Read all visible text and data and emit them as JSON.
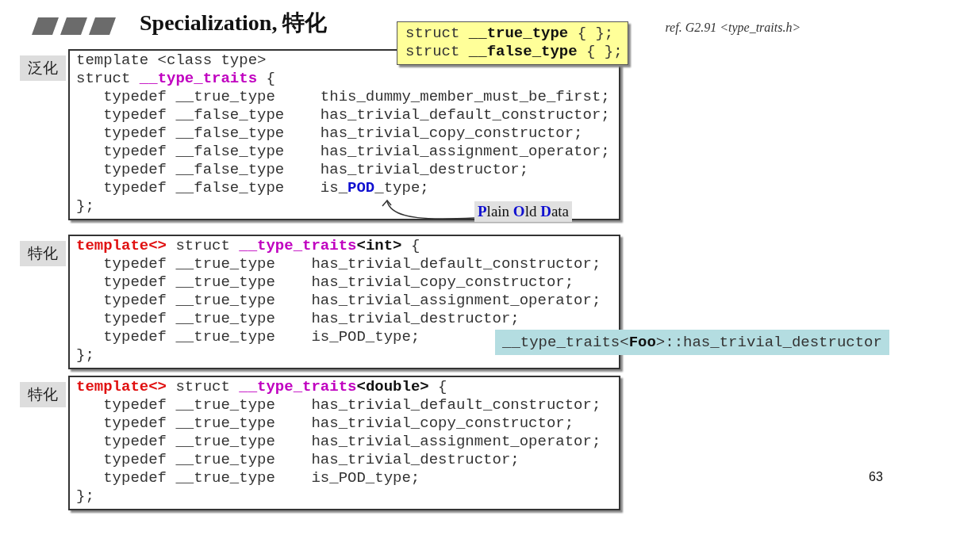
{
  "slide": {
    "title": "Specialization, 特化",
    "reference": "ref. G2.91 <type_traits.h>",
    "page_number": "63"
  },
  "note_box": {
    "lines": [
      [
        {
          "text": "struct ",
          "kind": "plain"
        },
        {
          "text": "__true_type",
          "kind": "bold"
        },
        {
          "text": " { };",
          "kind": "plain"
        }
      ],
      [
        {
          "text": "struct ",
          "kind": "plain"
        },
        {
          "text": "__false_type",
          "kind": "bold"
        },
        {
          "text": " { };",
          "kind": "plain"
        }
      ]
    ]
  },
  "blocks": [
    {
      "label": "泛化",
      "lines": [
        [
          {
            "text": "template <class type>",
            "kind": "plain"
          }
        ],
        [
          {
            "text": "struct ",
            "kind": "plain"
          },
          {
            "text": "__type_traits",
            "kind": "name"
          },
          {
            "text": " {",
            "kind": "plain"
          }
        ],
        [
          {
            "text": "   typedef __true_type     this_dummy_member_must_be_first;",
            "kind": "plain"
          }
        ],
        [
          {
            "text": "   typedef __false_type    has_trivial_default_constructor;",
            "kind": "plain"
          }
        ],
        [
          {
            "text": "   typedef __false_type    has_trivial_copy_constructor;",
            "kind": "plain"
          }
        ],
        [
          {
            "text": "   typedef __false_type    has_trivial_assignment_operator;",
            "kind": "plain"
          }
        ],
        [
          {
            "text": "   typedef __false_type    has_trivial_destructor;",
            "kind": "plain"
          }
        ],
        [
          {
            "text": "   typedef __false_type    is_",
            "kind": "plain"
          },
          {
            "text": "POD",
            "kind": "pod"
          },
          {
            "text": "_type;",
            "kind": "plain"
          }
        ],
        [
          {
            "text": "};",
            "kind": "plain"
          }
        ]
      ]
    },
    {
      "label": "特化",
      "lines": [
        [
          {
            "text": "template<>",
            "kind": "template"
          },
          {
            "text": " struct ",
            "kind": "plain"
          },
          {
            "text": "__type_traits",
            "kind": "name"
          },
          {
            "text": "<int>",
            "kind": "bold"
          },
          {
            "text": " {",
            "kind": "plain"
          }
        ],
        [
          {
            "text": "   typedef __true_type    has_trivial_default_constructor;",
            "kind": "plain"
          }
        ],
        [
          {
            "text": "   typedef __true_type    has_trivial_copy_constructor;",
            "kind": "plain"
          }
        ],
        [
          {
            "text": "   typedef __true_type    has_trivial_assignment_operator;",
            "kind": "plain"
          }
        ],
        [
          {
            "text": "   typedef __true_type    has_trivial_destructor;",
            "kind": "plain"
          }
        ],
        [
          {
            "text": "   typedef __true_type    is_POD_type;",
            "kind": "plain"
          }
        ],
        [
          {
            "text": "};",
            "kind": "plain"
          }
        ]
      ]
    },
    {
      "label": "特化",
      "lines": [
        [
          {
            "text": "template<>",
            "kind": "template"
          },
          {
            "text": " struct ",
            "kind": "plain"
          },
          {
            "text": "__type_traits",
            "kind": "name"
          },
          {
            "text": "<double>",
            "kind": "bold"
          },
          {
            "text": " {",
            "kind": "plain"
          }
        ],
        [
          {
            "text": "   typedef __true_type    has_trivial_default_constructor;",
            "kind": "plain"
          }
        ],
        [
          {
            "text": "   typedef __true_type    has_trivial_copy_constructor;",
            "kind": "plain"
          }
        ],
        [
          {
            "text": "   typedef __true_type    has_trivial_assignment_operator;",
            "kind": "plain"
          }
        ],
        [
          {
            "text": "   typedef __true_type    has_trivial_destructor;",
            "kind": "plain"
          }
        ],
        [
          {
            "text": "   typedef __true_type    is_POD_type;",
            "kind": "plain"
          }
        ],
        [
          {
            "text": "};",
            "kind": "plain"
          }
        ]
      ]
    }
  ],
  "pod_callout": {
    "segments": [
      {
        "text": "P",
        "kind": "initial"
      },
      {
        "text": "lain ",
        "kind": "plain"
      },
      {
        "text": "O",
        "kind": "initial"
      },
      {
        "text": "ld ",
        "kind": "plain"
      },
      {
        "text": "D",
        "kind": "initial"
      },
      {
        "text": "ata",
        "kind": "plain"
      }
    ]
  },
  "expression_box": {
    "segments": [
      {
        "text": "__type_traits<",
        "kind": "plain"
      },
      {
        "text": "Foo",
        "kind": "bold"
      },
      {
        "text": ">::has_trivial_destructor",
        "kind": "plain"
      }
    ]
  }
}
